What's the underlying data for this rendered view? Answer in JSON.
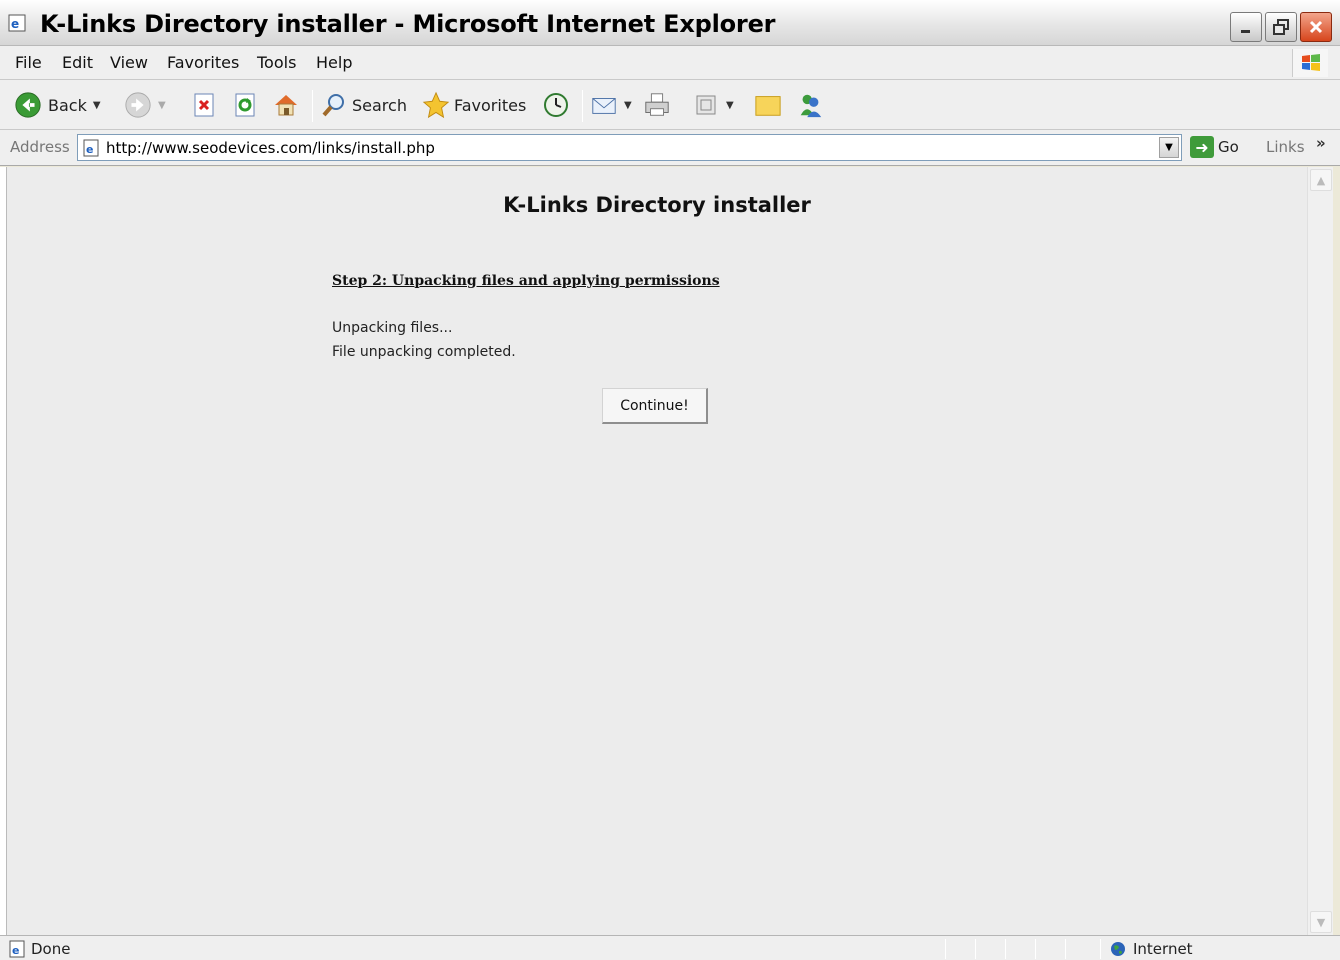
{
  "window": {
    "title": "K-Links Directory installer - Microsoft Internet Explorer"
  },
  "menu": {
    "items": [
      {
        "label": "File",
        "key": "F"
      },
      {
        "label": "Edit",
        "key": "E"
      },
      {
        "label": "View",
        "key": "V"
      },
      {
        "label": "Favorites",
        "key": "a"
      },
      {
        "label": "Tools",
        "key": "T"
      },
      {
        "label": "Help",
        "key": "H"
      }
    ]
  },
  "toolbar": {
    "back_label": "Back",
    "search_label": "Search",
    "favorites_label": "Favorites"
  },
  "address": {
    "label": "Address",
    "url": "http://www.seodevices.com/links/install.php",
    "go_label": "Go",
    "links_label": "Links"
  },
  "page": {
    "heading": "K-Links Directory installer",
    "step_title": "Step 2: Unpacking files and applying permissions",
    "messages": [
      "Unpacking files...",
      "File unpacking completed."
    ],
    "continue_label": "Continue!"
  },
  "status": {
    "text": "Done",
    "zone": "Internet"
  },
  "colors": {
    "chrome": "#efefef",
    "content_bg": "#ececec",
    "close_button": "#d7451c",
    "go_green": "#3f9b3a"
  }
}
